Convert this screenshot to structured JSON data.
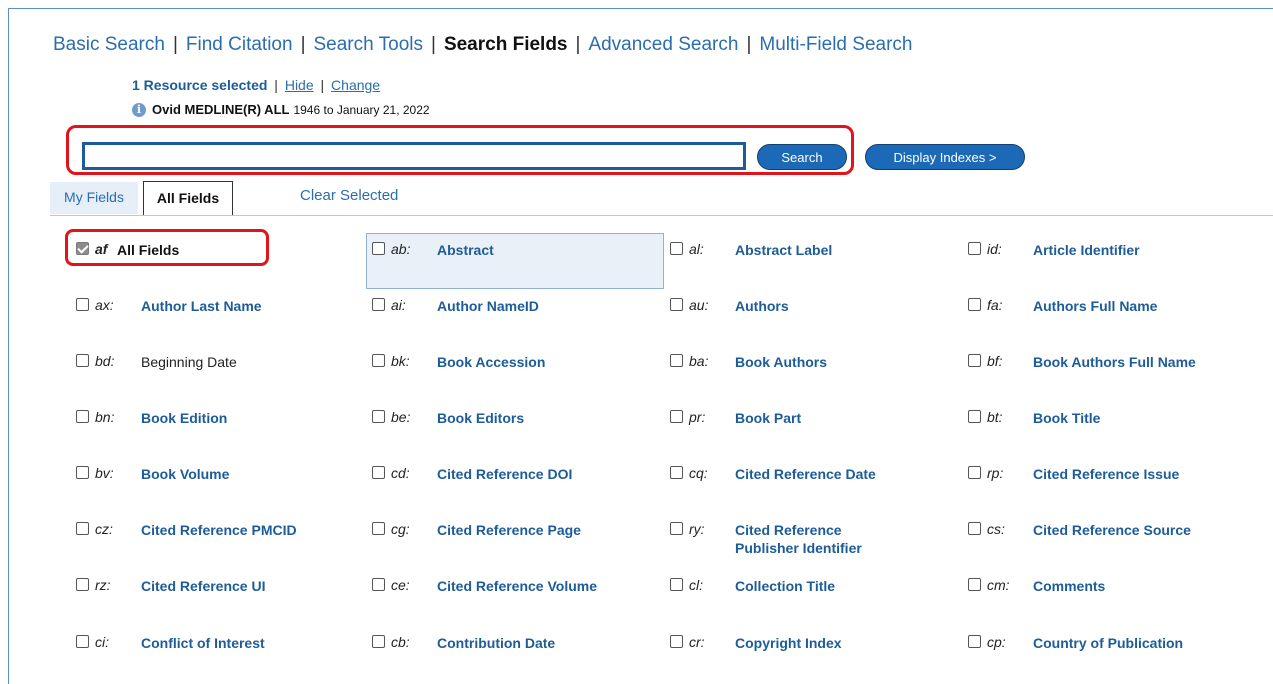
{
  "nav": {
    "tabs": [
      {
        "label": "Basic Search"
      },
      {
        "label": "Find Citation"
      },
      {
        "label": "Search Tools"
      },
      {
        "label": "Search Fields"
      },
      {
        "label": "Advanced Search"
      },
      {
        "label": "Multi-Field Search"
      }
    ],
    "separator": "|",
    "active_tab": "Search Fields"
  },
  "resource": {
    "selected_text": "1 Resource selected",
    "hide_label": "Hide",
    "change_label": "Change",
    "separator": "|",
    "database_name": "Ovid MEDLINE(R) ALL",
    "database_range": "1946 to January 21, 2022",
    "info_icon": "i"
  },
  "search": {
    "input_value": "",
    "search_label": "Search",
    "display_indexes_label": "Display Indexes >"
  },
  "tabs": {
    "my_fields": "My Fields",
    "all_fields": "All Fields",
    "active": "All Fields",
    "clear_selected": "Clear Selected"
  },
  "fields": [
    {
      "code": "af",
      "name": "All Fields",
      "checked": true
    },
    {
      "code": "ab:",
      "name": "Abstract",
      "checked": false
    },
    {
      "code": "al:",
      "name": "Abstract Label",
      "checked": false
    },
    {
      "code": "id:",
      "name": "Article Identifier",
      "checked": false
    },
    {
      "code": "ax:",
      "name": "Author Last Name",
      "checked": false
    },
    {
      "code": "ai:",
      "name": "Author NameID",
      "checked": false
    },
    {
      "code": "au:",
      "name": "Authors",
      "checked": false
    },
    {
      "code": "fa:",
      "name": "Authors Full Name",
      "checked": false
    },
    {
      "code": "bd:",
      "name": "Beginning Date",
      "checked": false
    },
    {
      "code": "bk:",
      "name": "Book Accession",
      "checked": false
    },
    {
      "code": "ba:",
      "name": "Book Authors",
      "checked": false
    },
    {
      "code": "bf:",
      "name": "Book Authors Full Name",
      "checked": false
    },
    {
      "code": "bn:",
      "name": "Book Edition",
      "checked": false
    },
    {
      "code": "be:",
      "name": "Book Editors",
      "checked": false
    },
    {
      "code": "pr:",
      "name": "Book Part",
      "checked": false
    },
    {
      "code": "bt:",
      "name": "Book Title",
      "checked": false
    },
    {
      "code": "bv:",
      "name": "Book Volume",
      "checked": false
    },
    {
      "code": "cd:",
      "name": "Cited Reference DOI",
      "checked": false
    },
    {
      "code": "cq:",
      "name": "Cited Reference Date",
      "checked": false
    },
    {
      "code": "rp:",
      "name": "Cited Reference Issue",
      "checked": false
    },
    {
      "code": "cz:",
      "name": "Cited Reference PMCID",
      "checked": false
    },
    {
      "code": "cg:",
      "name": "Cited Reference Page",
      "checked": false
    },
    {
      "code": "ry:",
      "name": "Cited Reference Publisher Identifier",
      "checked": false
    },
    {
      "code": "cs:",
      "name": "Cited Reference Source",
      "checked": false
    },
    {
      "code": "rz:",
      "name": "Cited Reference UI",
      "checked": false
    },
    {
      "code": "ce:",
      "name": "Cited Reference Volume",
      "checked": false
    },
    {
      "code": "cl:",
      "name": "Collection Title",
      "checked": false
    },
    {
      "code": "cm:",
      "name": "Comments",
      "checked": false
    },
    {
      "code": "ci:",
      "name": "Conflict of Interest",
      "checked": false
    },
    {
      "code": "cb:",
      "name": "Contribution Date",
      "checked": false
    },
    {
      "code": "cr:",
      "name": "Copyright Index",
      "checked": false
    },
    {
      "code": "cp:",
      "name": "Country of Publication",
      "checked": false
    }
  ],
  "colors": {
    "link_blue": "#2a6ead",
    "field_blue": "#1d5c98",
    "button_blue": "#1c6ab7",
    "highlight_red": "#e0141a",
    "input_border": "#1f5a9c"
  }
}
